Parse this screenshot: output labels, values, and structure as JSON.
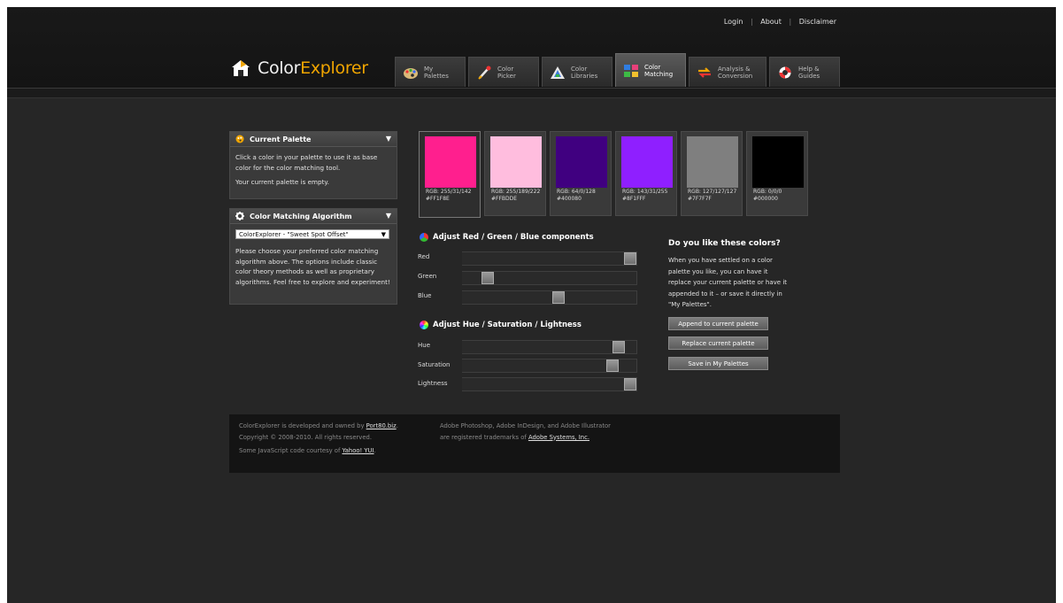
{
  "toplinks": [
    "Login",
    "About",
    "Disclaimer"
  ],
  "logo": {
    "part1": "Color",
    "part2": "Explorer"
  },
  "tabs": [
    {
      "label": "My\nPalettes",
      "icon": "palette-icon",
      "active": false
    },
    {
      "label": "Color\nPicker",
      "icon": "eyedropper-icon",
      "active": false
    },
    {
      "label": "Color\nLibraries",
      "icon": "library-icon",
      "active": false
    },
    {
      "label": "Color\nMatching",
      "icon": "color-matching-icon",
      "active": true
    },
    {
      "label": "Analysis &\nConversion",
      "icon": "conversion-arrows-icon",
      "active": false
    },
    {
      "label": "Help &\nGuides",
      "icon": "lifebuoy-icon",
      "active": false
    }
  ],
  "current_palette": {
    "title": "Current Palette",
    "text1": "Click a color in your palette to use it as base color for the color matching tool.",
    "text2": "Your current palette is empty."
  },
  "algorithm": {
    "title": "Color Matching Algorithm",
    "selected": "ColorExplorer - \"Sweet Spot Offset\"",
    "text": "Please choose your preferred color matching algorithm above. The options include classic color theory methods as well as proprietary algorithms. Feel free to explore and experiment!"
  },
  "swatches": [
    {
      "hex": "#FF1F8E",
      "rgb_label": "RGB: 255/31/142",
      "hex_label": "#FF1F8E",
      "selected": true
    },
    {
      "hex": "#FFBDDE",
      "rgb_label": "RGB: 255/189/222",
      "hex_label": "#FFBDDE",
      "selected": false
    },
    {
      "hex": "#400080",
      "rgb_label": "RGB: 64/0/128",
      "hex_label": "#400080",
      "selected": false
    },
    {
      "hex": "#8F1FFF",
      "rgb_label": "RGB: 143/31/255",
      "hex_label": "#8F1FFF",
      "selected": false
    },
    {
      "hex": "#7F7F7F",
      "rgb_label": "RGB: 127/127/127",
      "hex_label": "#7F7F7F",
      "selected": false
    },
    {
      "hex": "#000000",
      "rgb_label": "RGB: 0/0/0",
      "hex_label": "#000000",
      "selected": false
    }
  ],
  "rgb_section": {
    "title": "Adjust Red / Green / Blue components",
    "sliders": [
      {
        "label": "Red",
        "value": 1.0
      },
      {
        "label": "Green",
        "value": 0.12
      },
      {
        "label": "Blue",
        "value": 0.56
      }
    ]
  },
  "hsl_section": {
    "title": "Adjust Hue / Saturation / Lightness",
    "sliders": [
      {
        "label": "Hue",
        "value": 0.93
      },
      {
        "label": "Saturation",
        "value": 0.89
      },
      {
        "label": "Lightness",
        "value": 1.0
      }
    ]
  },
  "right": {
    "title": "Do you like these colors?",
    "text": "When you have settled on a color palette you like, you can have it replace your current palette or have it appended to it – or save it directly in \"My Palettes\".",
    "buttons": [
      "Append to current palette",
      "Replace current palette",
      "Save in My Palettes"
    ]
  },
  "footer": {
    "l1_pre": "ColorExplorer is developed and owned by ",
    "l1_link": "Port80.biz",
    "l1_post": ".",
    "l2": "Copyright © 2008-2010. All rights reserved.",
    "l3_pre": "Some JavaScript code courtesy of ",
    "l3_link": "Yahoo! YUI",
    "l3_post": ".",
    "r1": "Adobe Photoshop, Adobe InDesign, and Adobe Illustrator",
    "r2_pre": "are registered trademarks of ",
    "r2_link": "Adobe Systems, Inc."
  },
  "colors": {
    "accent": "#F0A500",
    "background": "#262626",
    "header": "#171717"
  }
}
